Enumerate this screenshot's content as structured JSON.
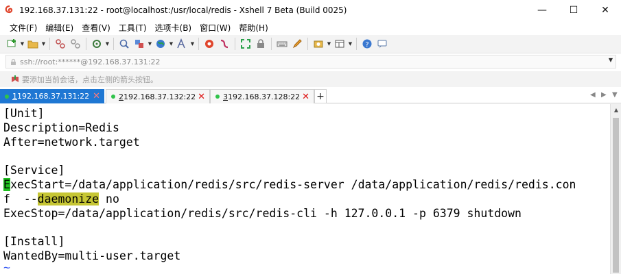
{
  "window": {
    "title": "192.168.37.131:22 - root@localhost:/usr/local/redis - Xshell 7 Beta (Build 0025)",
    "controls": {
      "minimize": "—",
      "maximize": "☐",
      "close": "✕"
    }
  },
  "menubar": {
    "items": [
      "文件(F)",
      "编辑(E)",
      "查看(V)",
      "工具(T)",
      "选项卡(B)",
      "窗口(W)",
      "帮助(H)"
    ]
  },
  "address": {
    "text": "ssh://root:******@192.168.37.131:22"
  },
  "hint": {
    "text": "要添加当前会话，点击左侧的箭头按钮。"
  },
  "tabs": [
    {
      "num": "1",
      "label": " 192.168.37.131:22",
      "active": true
    },
    {
      "num": "2",
      "label": " 192.168.37.132:22",
      "active": false
    },
    {
      "num": "3",
      "label": " 192.168.37.128:22",
      "active": false
    }
  ],
  "tab_add": "+",
  "terminal": {
    "lines": [
      "[Unit]",
      "Description=Redis",
      "After=network.target",
      "",
      "[Service]",
      {
        "cursor": "E",
        "rest": "xecStart=/data/application/redis/src/redis-server /data/application/redis/redis.con"
      },
      {
        "pre": "f  --",
        "hl": "daemonize",
        "post": " no"
      },
      "ExecStop=/data/application/redis/src/redis-cli -h 127.0.0.1 -p 6379 shutdown",
      "",
      "[Install]",
      "WantedBy=multi-user.target",
      "~"
    ]
  },
  "colors": {
    "active_tab": "#1e77d3",
    "cursor": "#1fc01f",
    "highlight": "#c6c634",
    "tilde": "#3a5cf4"
  }
}
